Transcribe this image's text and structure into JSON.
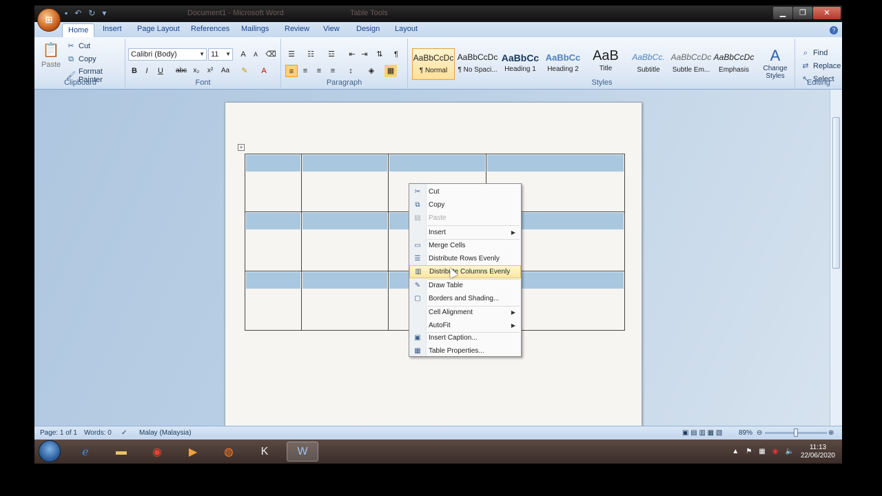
{
  "window": {
    "title_doc": "Document1",
    "title_sep": " - ",
    "title_app": "Microsoft Word",
    "table_tools": "Table Tools",
    "office_button_icon": "office-logo-icon"
  },
  "tabs": [
    "Home",
    "Insert",
    "Page Layout",
    "References",
    "Mailings",
    "Review",
    "View",
    "Design",
    "Layout"
  ],
  "ribbon": {
    "clipboard": {
      "label": "Clipboard",
      "paste": "Paste",
      "cut": "Cut",
      "copy": "Copy",
      "format_painter": "Format Painter"
    },
    "font": {
      "label": "Font",
      "font_name": "Calibri (Body)",
      "font_size": "11"
    },
    "paragraph": {
      "label": "Paragraph"
    },
    "styles": {
      "label": "Styles",
      "items": [
        {
          "sample": "AaBbCcDc",
          "name": "¶ Normal"
        },
        {
          "sample": "AaBbCcDc",
          "name": "¶ No Spaci..."
        },
        {
          "sample": "AaBbCc",
          "name": "Heading 1"
        },
        {
          "sample": "AaBbCc",
          "name": "Heading 2"
        },
        {
          "sample": "AaB",
          "name": "Title"
        },
        {
          "sample": "AaBbCc.",
          "name": "Subtitle"
        },
        {
          "sample": "AaBbCcDc",
          "name": "Subtle Em..."
        },
        {
          "sample": "AaBbCcDc",
          "name": "Emphasis"
        }
      ],
      "change_styles": "Change Styles"
    },
    "editing": {
      "label": "Editing",
      "find": "Find",
      "replace": "Replace",
      "select": "Select"
    }
  },
  "context_menu": {
    "items": [
      {
        "label": "Cut",
        "icon": "scissors-icon"
      },
      {
        "label": "Copy",
        "icon": "copy-icon"
      },
      {
        "label": "Paste",
        "icon": "paste-icon",
        "disabled": true
      },
      {
        "label": "Insert",
        "submenu": true
      },
      {
        "label": "Merge Cells",
        "icon": "merge-cells-icon"
      },
      {
        "label": "Distribute Rows Evenly",
        "icon": "distribute-rows-icon"
      },
      {
        "label": "Distribute Columns Evenly",
        "icon": "distribute-columns-icon",
        "highlighted": true
      },
      {
        "label": "Draw Table",
        "icon": "pencil-icon"
      },
      {
        "label": "Borders and Shading...",
        "icon": "borders-icon"
      },
      {
        "label": "Cell Alignment",
        "submenu": true
      },
      {
        "label": "AutoFit",
        "submenu": true
      },
      {
        "label": "Insert Caption...",
        "icon": "caption-icon"
      },
      {
        "label": "Table Properties...",
        "icon": "table-properties-icon"
      }
    ]
  },
  "statusbar": {
    "page": "Page: 1 of 1",
    "words": "Words: 0",
    "language": "Malay (Malaysia)",
    "zoom": "89%"
  },
  "taskbar": {
    "time": "11:13",
    "date": "22/06/2020"
  }
}
